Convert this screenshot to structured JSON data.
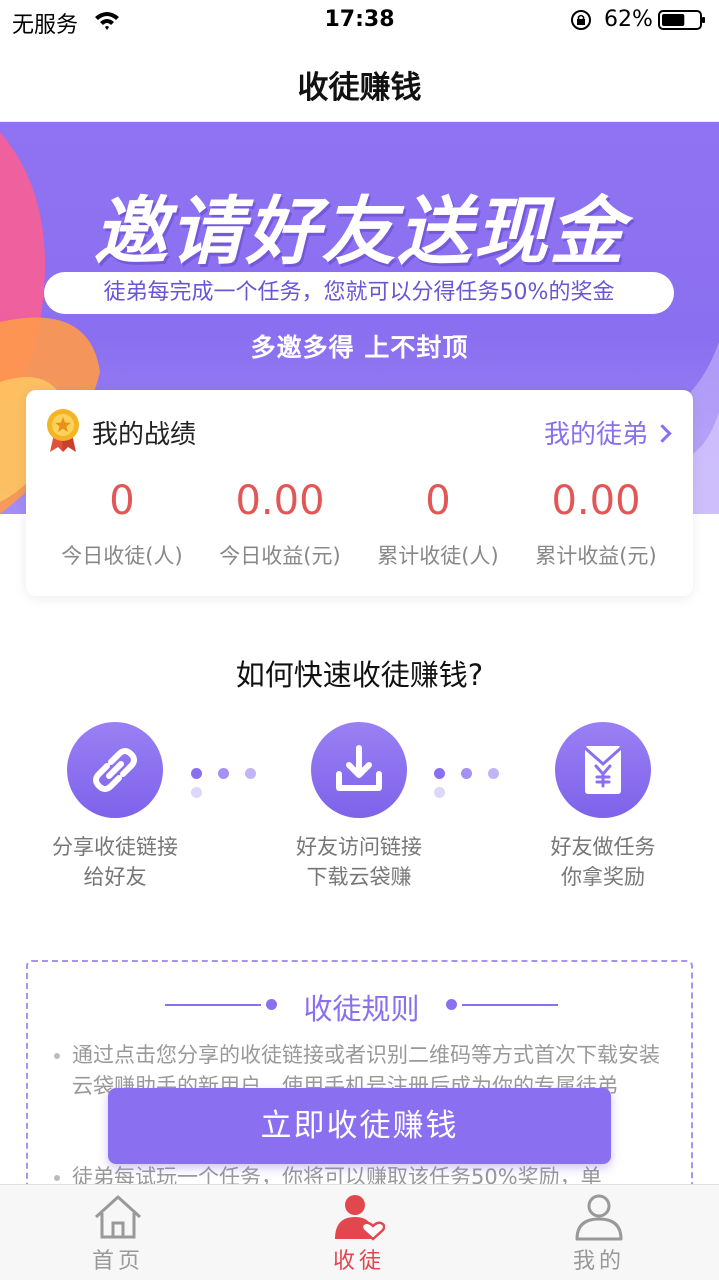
{
  "status_bar": {
    "carrier": "无服务",
    "time": "17:38",
    "battery": "62%",
    "battery_level": 0.62
  },
  "nav": {
    "title": "收徒赚钱"
  },
  "hero": {
    "title": "邀请好友送现金",
    "pill": "徒弟每完成一个任务，您就可以分得任务50%的奖金",
    "subtitle": "多邀多得   上不封顶"
  },
  "stats_card": {
    "title": "我的战绩",
    "link_label": "我的徒弟",
    "stats": [
      {
        "value": "0",
        "label": "今日收徒(人)"
      },
      {
        "value": "0.00",
        "label": "今日收益(元)"
      },
      {
        "value": "0",
        "label": "累计收徒(人)"
      },
      {
        "value": "0.00",
        "label": "累计收益(元)"
      }
    ]
  },
  "how": {
    "title": "如何快速收徒赚钱?",
    "steps": [
      {
        "icon": "link-icon",
        "line1": "分享收徒链接",
        "line2": "给好友"
      },
      {
        "icon": "download-icon",
        "line1": "好友访问链接",
        "line2": "下载云袋赚"
      },
      {
        "icon": "yuan-envelope-icon",
        "line1": "好友做任务",
        "line2": "你拿奖励"
      }
    ]
  },
  "rules": {
    "title": "收徒规则",
    "items": [
      "通过点击您分享的收徒链接或者识别二维码等方式首次下载安装云袋赚助手的新用户，使用手机号注册后成为你的专属徒弟",
      "徒弟每试玩一个任务，你将可以赚取该任务50%奖励，单"
    ]
  },
  "cta": {
    "label": "立即收徒赚钱"
  },
  "tabs": [
    {
      "label": "首页",
      "icon": "home-icon",
      "active": false
    },
    {
      "label": "收徒",
      "icon": "user-heart-icon",
      "active": true
    },
    {
      "label": "我的",
      "icon": "user-icon",
      "active": false
    }
  ],
  "colors": {
    "accent": "#8a6ff0",
    "stat_value": "#e35656",
    "tab_active": "#e2474e",
    "tab_inactive": "#999999"
  }
}
